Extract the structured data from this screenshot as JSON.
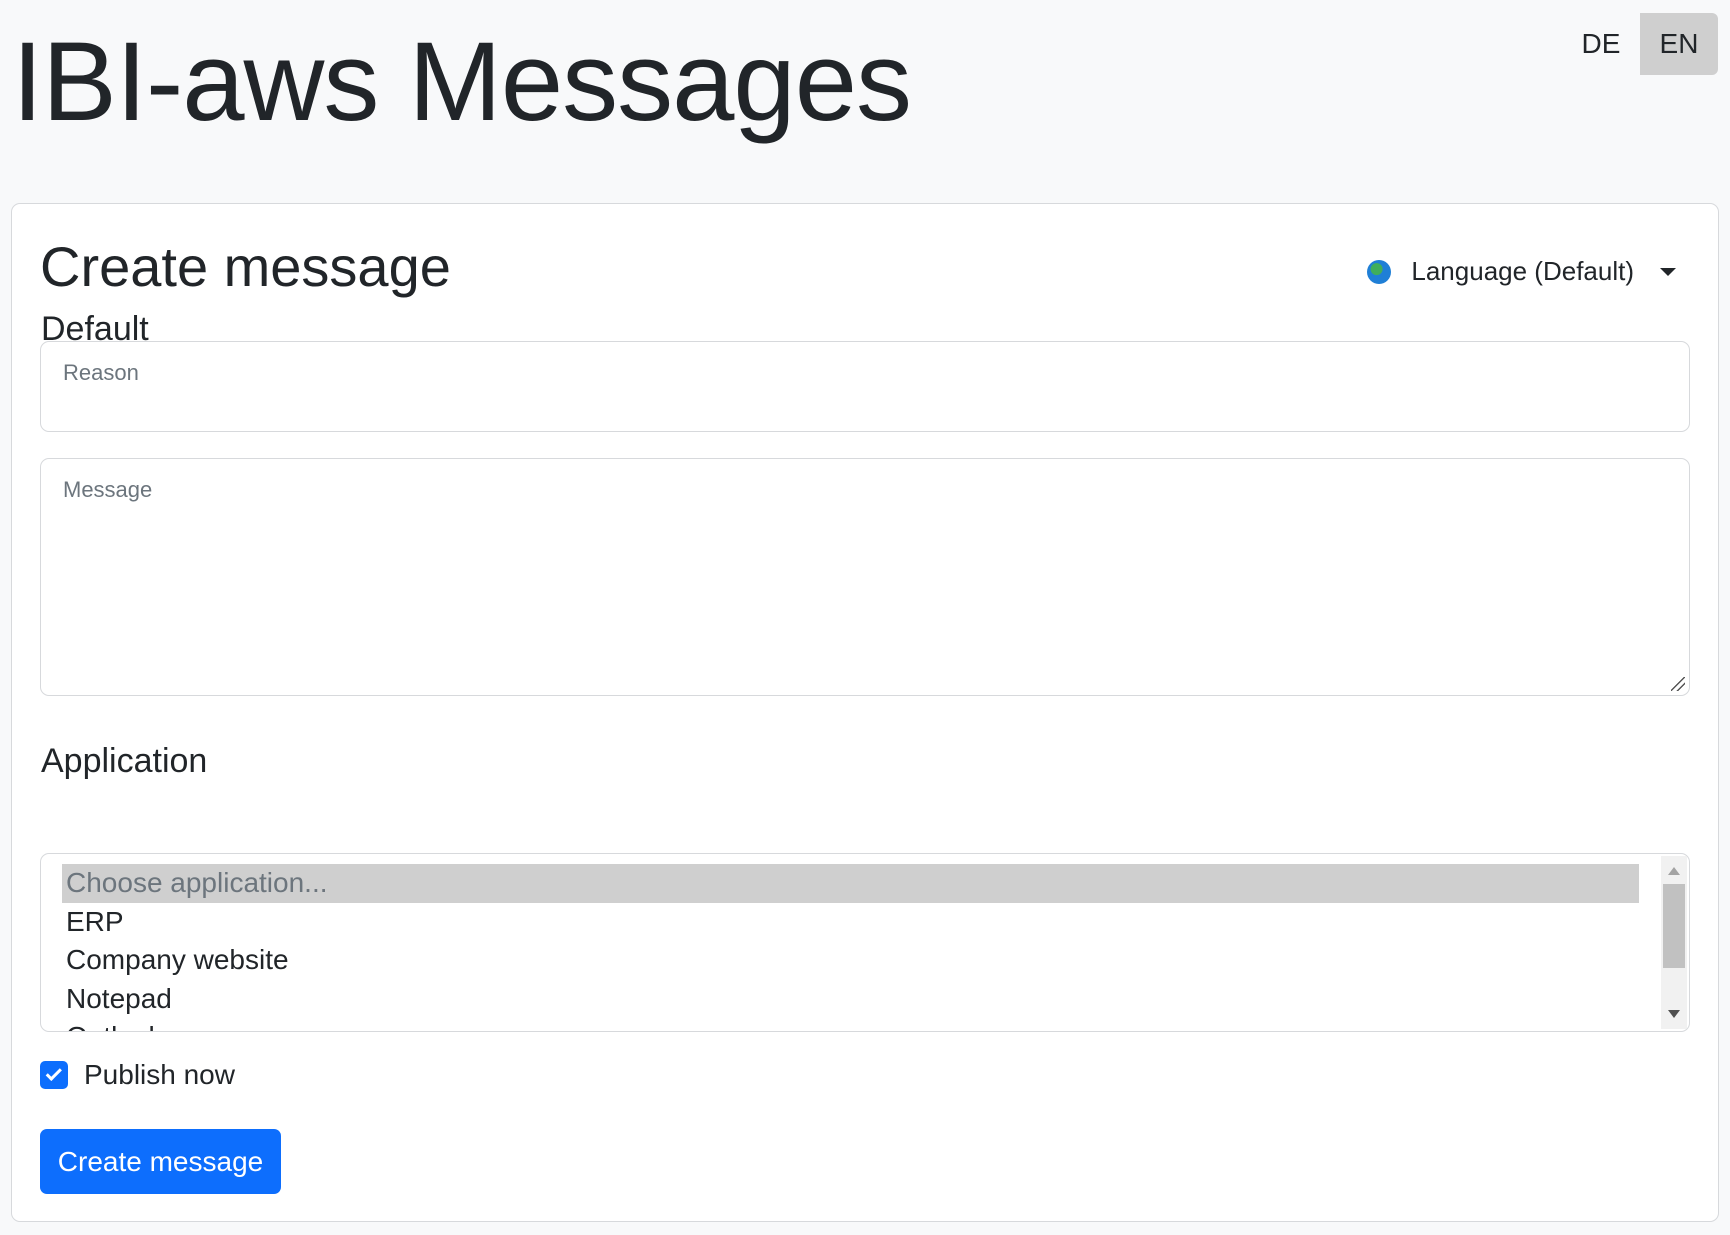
{
  "header": {
    "title": "IBI-aws Messages",
    "languages": [
      {
        "label": "DE",
        "active": false
      },
      {
        "label": "EN",
        "active": true
      }
    ]
  },
  "form": {
    "title": "Create message",
    "language_dropdown": {
      "icon": "globe-icon",
      "label": "Language (Default)"
    },
    "section_default": "Default",
    "reason": {
      "label": "Reason",
      "value": ""
    },
    "message": {
      "label": "Message",
      "value": ""
    },
    "section_application": "Application",
    "application_options": [
      "Choose application...",
      "ERP",
      "Company website",
      "Notepad",
      "Outlook"
    ],
    "application_selected": "Choose application...",
    "publish_now": {
      "label": "Publish now",
      "checked": true
    },
    "submit_label": "Create message"
  },
  "colors": {
    "primary": "#0d6efd",
    "background": "#f8f9fa",
    "active_lang": "#cfcfcf"
  }
}
